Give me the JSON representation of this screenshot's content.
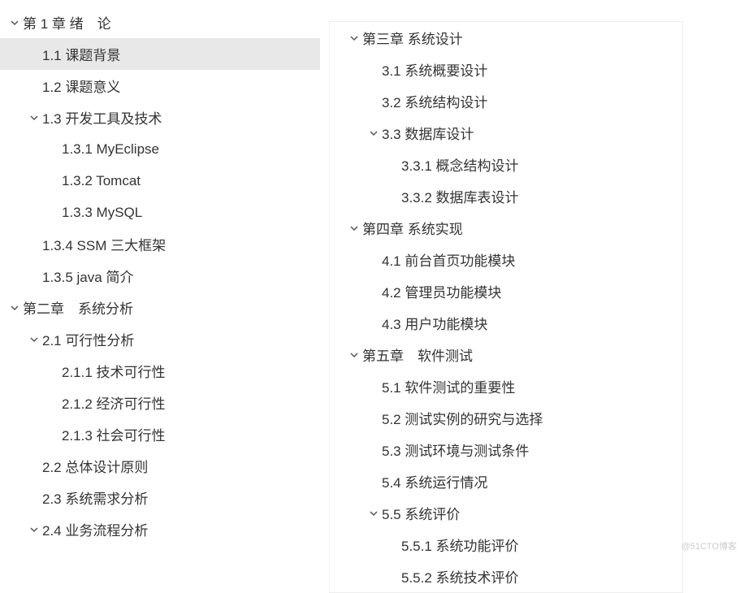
{
  "watermark": "@51CTO博客",
  "left": [
    {
      "level": 0,
      "expand": "open",
      "text": "第 1 章 绪　论",
      "selected": false
    },
    {
      "level": 1,
      "expand": "none",
      "text": "1.1 课题背景",
      "selected": true
    },
    {
      "level": 1,
      "expand": "none",
      "text": "1.2 课题意义",
      "selected": false
    },
    {
      "level": 1,
      "expand": "open",
      "text": "1.3 开发工具及技术",
      "selected": false
    },
    {
      "level": 2,
      "expand": "none",
      "text": "1.3.1 MyEclipse",
      "selected": false
    },
    {
      "level": 2,
      "expand": "none",
      "text": "1.3.2 Tomcat",
      "selected": false
    },
    {
      "level": 2,
      "expand": "none",
      "text": "1.3.3 MySQL",
      "selected": false
    },
    {
      "level": 1,
      "expand": "none",
      "text": "1.3.4 SSM 三大框架",
      "selected": false
    },
    {
      "level": 1,
      "expand": "none",
      "text": "1.3.5 java 简介",
      "selected": false
    },
    {
      "level": 0,
      "expand": "open",
      "text": "第二章　系统分析",
      "selected": false
    },
    {
      "level": 1,
      "expand": "open",
      "text": "2.1 可行性分析",
      "selected": false
    },
    {
      "level": 2,
      "expand": "none",
      "text": "2.1.1 技术可行性",
      "selected": false
    },
    {
      "level": 2,
      "expand": "none",
      "text": "2.1.2 经济可行性",
      "selected": false
    },
    {
      "level": 2,
      "expand": "none",
      "text": "2.1.3 社会可行性",
      "selected": false
    },
    {
      "level": 1,
      "expand": "none",
      "text": "2.2 总体设计原则",
      "selected": false
    },
    {
      "level": 1,
      "expand": "none",
      "text": "2.3 系统需求分析",
      "selected": false
    },
    {
      "level": 1,
      "expand": "open",
      "text": "2.4 业务流程分析",
      "selected": false
    }
  ],
  "right": [
    {
      "level": 0,
      "expand": "open",
      "text": "第三章 系统设计",
      "selected": false
    },
    {
      "level": 1,
      "expand": "none",
      "text": "3.1 系统概要设计",
      "selected": false
    },
    {
      "level": 1,
      "expand": "none",
      "text": "3.2 系统结构设计",
      "selected": false
    },
    {
      "level": 1,
      "expand": "open",
      "text": "3.3 数据库设计",
      "selected": false
    },
    {
      "level": 2,
      "expand": "none",
      "text": "3.3.1 概念结构设计",
      "selected": false
    },
    {
      "level": 2,
      "expand": "none",
      "text": "3.3.2 数据库表设计",
      "selected": false
    },
    {
      "level": 0,
      "expand": "open",
      "text": "第四章 系统实现",
      "selected": false
    },
    {
      "level": 1,
      "expand": "none",
      "text": "4.1 前台首页功能模块",
      "selected": false
    },
    {
      "level": 1,
      "expand": "none",
      "text": "4.2 管理员功能模块",
      "selected": false
    },
    {
      "level": 1,
      "expand": "none",
      "text": "4.3 用户功能模块",
      "selected": false
    },
    {
      "level": 0,
      "expand": "open",
      "text": "第五章　软件测试",
      "selected": false
    },
    {
      "level": 1,
      "expand": "none",
      "text": "5.1 软件测试的重要性",
      "selected": false
    },
    {
      "level": 1,
      "expand": "none",
      "text": "5.2 测试实例的研究与选择",
      "selected": false
    },
    {
      "level": 1,
      "expand": "none",
      "text": "5.3 测试环境与测试条件",
      "selected": false
    },
    {
      "level": 1,
      "expand": "none",
      "text": "5.4 系统运行情况",
      "selected": false
    },
    {
      "level": 1,
      "expand": "open",
      "text": "5.5 系统评价",
      "selected": false
    },
    {
      "level": 2,
      "expand": "none",
      "text": "5.5.1 系统功能评价",
      "selected": false
    },
    {
      "level": 2,
      "expand": "none",
      "text": "5.5.2 系统技术评价",
      "selected": false
    }
  ]
}
